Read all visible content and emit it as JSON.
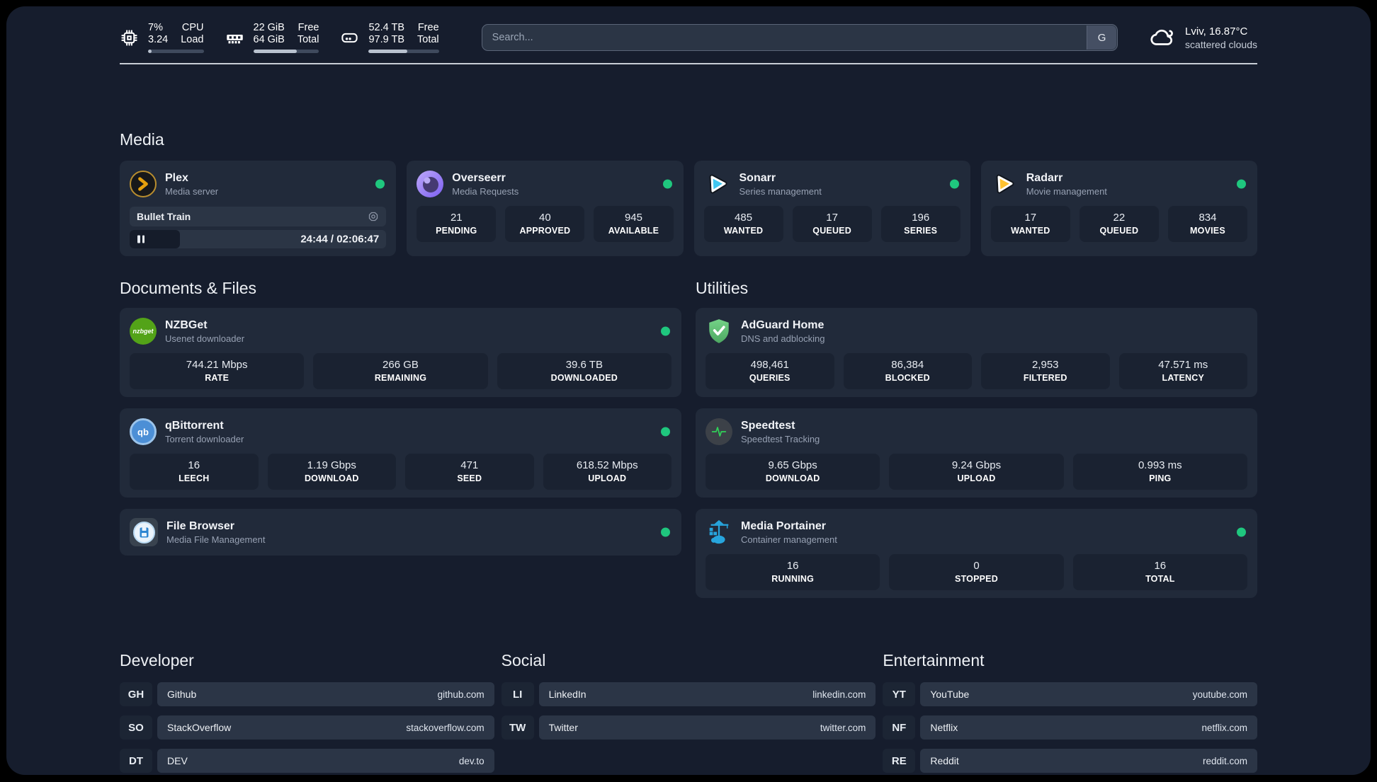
{
  "header": {
    "system": {
      "cpu": {
        "values": [
          "7%",
          "3.24"
        ],
        "labels": [
          "CPU",
          "Load"
        ],
        "fill_style": "width:7%"
      },
      "memory": {
        "values": [
          "22 GiB",
          "64 GiB"
        ],
        "labels": [
          "Free",
          "Total"
        ],
        "fill_style": "width:66%"
      },
      "disk": {
        "values": [
          "52.4 TB",
          "97.9 TB"
        ],
        "labels": [
          "Free",
          "Total"
        ],
        "fill_style": "width:55%"
      }
    },
    "search": {
      "placeholder": "Search...",
      "engine_button": "G"
    },
    "weather": {
      "location": "Lviv, 16.87°C",
      "condition": "scattered clouds"
    }
  },
  "sections": {
    "media": "Media",
    "documents": "Documents & Files",
    "utilities": "Utilities",
    "developer": "Developer",
    "social": "Social",
    "entertainment": "Entertainment"
  },
  "apps": {
    "plex": {
      "name": "Plex",
      "desc": "Media server",
      "now_playing": "Bullet Train",
      "time": "24:44 / 02:06:47",
      "progress_style": "width:19.5%"
    },
    "overseerr": {
      "name": "Overseerr",
      "desc": "Media Requests",
      "stats": [
        {
          "value": "21",
          "label": "PENDING"
        },
        {
          "value": "40",
          "label": "APPROVED"
        },
        {
          "value": "945",
          "label": "AVAILABLE"
        }
      ]
    },
    "sonarr": {
      "name": "Sonarr",
      "desc": "Series management",
      "stats": [
        {
          "value": "485",
          "label": "WANTED"
        },
        {
          "value": "17",
          "label": "QUEUED"
        },
        {
          "value": "196",
          "label": "SERIES"
        }
      ]
    },
    "radarr": {
      "name": "Radarr",
      "desc": "Movie management",
      "stats": [
        {
          "value": "17",
          "label": "WANTED"
        },
        {
          "value": "22",
          "label": "QUEUED"
        },
        {
          "value": "834",
          "label": "MOVIES"
        }
      ]
    },
    "nzbget": {
      "name": "NZBGet",
      "desc": "Usenet downloader",
      "icon_text": "nzbget",
      "stats": [
        {
          "value": "744.21 Mbps",
          "label": "RATE"
        },
        {
          "value": "266 GB",
          "label": "REMAINING"
        },
        {
          "value": "39.6 TB",
          "label": "DOWNLOADED"
        }
      ]
    },
    "qbittorrent": {
      "name": "qBittorrent",
      "desc": "Torrent downloader",
      "icon_text": "qb",
      "stats": [
        {
          "value": "16",
          "label": "LEECH"
        },
        {
          "value": "1.19 Gbps",
          "label": "DOWNLOAD"
        },
        {
          "value": "471",
          "label": "SEED"
        },
        {
          "value": "618.52 Mbps",
          "label": "UPLOAD"
        }
      ]
    },
    "filebrowser": {
      "name": "File Browser",
      "desc": "Media File Management"
    },
    "adguard": {
      "name": "AdGuard Home",
      "desc": "DNS and adblocking",
      "stats": [
        {
          "value": "498,461",
          "label": "QUERIES"
        },
        {
          "value": "86,384",
          "label": "BLOCKED"
        },
        {
          "value": "2,953",
          "label": "FILTERED"
        },
        {
          "value": "47.571 ms",
          "label": "LATENCY"
        }
      ]
    },
    "speedtest": {
      "name": "Speedtest",
      "desc": "Speedtest Tracking",
      "stats": [
        {
          "value": "9.65 Gbps",
          "label": "DOWNLOAD"
        },
        {
          "value": "9.24 Gbps",
          "label": "UPLOAD"
        },
        {
          "value": "0.993 ms",
          "label": "PING"
        }
      ]
    },
    "portainer": {
      "name": "Media Portainer",
      "desc": "Container management",
      "stats": [
        {
          "value": "16",
          "label": "RUNNING"
        },
        {
          "value": "0",
          "label": "STOPPED"
        },
        {
          "value": "16",
          "label": "TOTAL"
        }
      ]
    }
  },
  "links": {
    "developer": [
      {
        "abbr": "GH",
        "name": "Github",
        "url": "github.com"
      },
      {
        "abbr": "SO",
        "name": "StackOverflow",
        "url": "stackoverflow.com"
      },
      {
        "abbr": "DT",
        "name": "DEV",
        "url": "dev.to"
      }
    ],
    "social": [
      {
        "abbr": "LI",
        "name": "LinkedIn",
        "url": "linkedin.com"
      },
      {
        "abbr": "TW",
        "name": "Twitter",
        "url": "twitter.com"
      }
    ],
    "entertainment": [
      {
        "abbr": "YT",
        "name": "YouTube",
        "url": "youtube.com"
      },
      {
        "abbr": "NF",
        "name": "Netflix",
        "url": "netflix.com"
      },
      {
        "abbr": "RE",
        "name": "Reddit",
        "url": "reddit.com"
      }
    ]
  },
  "colors": {
    "status_online": "#1fc77e",
    "background": "#161d2d",
    "card": "#212a3a"
  }
}
